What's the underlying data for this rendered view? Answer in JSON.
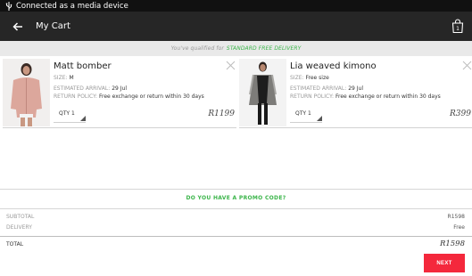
{
  "status_bar": {
    "text": "Connected as a media device",
    "icon": "usb-icon"
  },
  "toolbar": {
    "title": "My Cart",
    "cart_count": "1",
    "back_icon": "back-arrow-icon"
  },
  "banner": {
    "prefix": "You've qualified for",
    "highlight": "STANDARD FREE DELIVERY"
  },
  "items": [
    {
      "name": "Matt bomber",
      "size_label": "SIZE:",
      "size": "M",
      "arrival_label": "ESTIMATED ARRIVAL:",
      "arrival": "29 Jul",
      "policy_label": "RETURN POLICY:",
      "policy": "Free exchange or return within 30 days",
      "qty": "QTY 1",
      "price": "R1199"
    },
    {
      "name": "Lia weaved kimono",
      "size_label": "SIZE:",
      "size": "Free size",
      "arrival_label": "ESTIMATED ARRIVAL:",
      "arrival": "29 Jul",
      "policy_label": "RETURN POLICY:",
      "policy": "Free exchange or return within 30 days",
      "qty": "QTY 1",
      "price": "R399"
    }
  ],
  "promo": "DO YOU HAVE A PROMO CODE?",
  "summary": {
    "subtotal_label": "SUBTOTAL",
    "subtotal": "R1598",
    "delivery_label": "DELIVERY",
    "delivery": "Free",
    "total_label": "TOTAL",
    "total": "R1598"
  },
  "next_label": "NEXT",
  "colors": {
    "accent_green": "#3bb54a",
    "next_red": "#f4283c",
    "toolbar": "#262626"
  }
}
